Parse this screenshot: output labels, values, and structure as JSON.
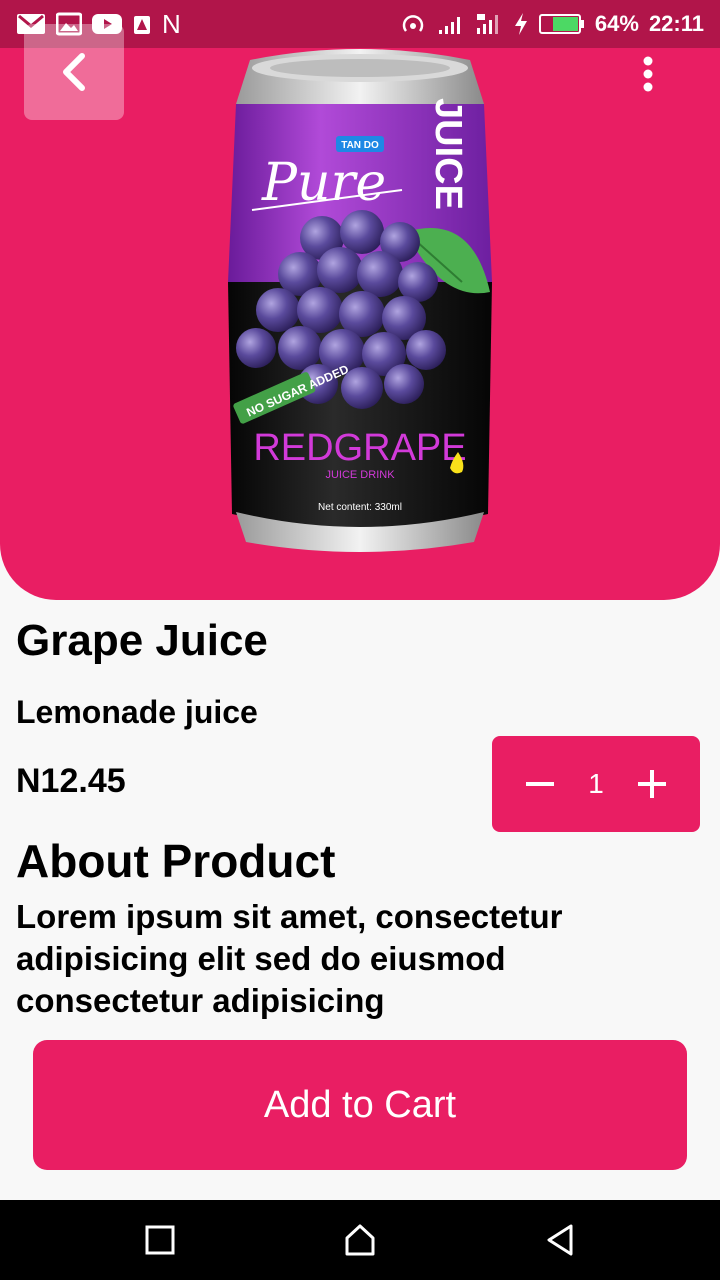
{
  "status_bar": {
    "carrier_glyph": "N",
    "battery_percent": "64%",
    "time": "22:11",
    "icons": [
      "gmail-icon",
      "gallery-icon",
      "youtube-icon",
      "notification-icon",
      "hotspot-icon",
      "signal-icon",
      "data-signal-icon",
      "charging-icon",
      "battery-icon"
    ],
    "background": "#b1154a"
  },
  "header": {
    "back_icon": "chevron-left-icon",
    "menu_icon": "more-vertical-icon"
  },
  "product_image": {
    "brand": "TAN DO",
    "script_word": "Pure",
    "side_word": "JUICE",
    "flavor": "REDGRAPE",
    "line": "JUICE DRINK",
    "volume": "Net content: 330ml",
    "claim": "NO SUGAR ADDED"
  },
  "product": {
    "name": "Grape Juice",
    "category": "Lemonade juice",
    "price": "N12.45",
    "quantity": "1"
  },
  "about": {
    "heading": "About Product",
    "text": "Lorem ipsum sit amet, consectetur adipisicing elit sed do eiusmod consectetur adipisicing"
  },
  "actions": {
    "add_to_cart": "Add to Cart"
  },
  "colors": {
    "accent": "#e91e63",
    "status_bar": "#b1154a",
    "page_background": "#f8f8f8"
  },
  "nav_bar": {
    "items": [
      "recents-square-icon",
      "home-icon",
      "back-triangle-icon"
    ]
  }
}
